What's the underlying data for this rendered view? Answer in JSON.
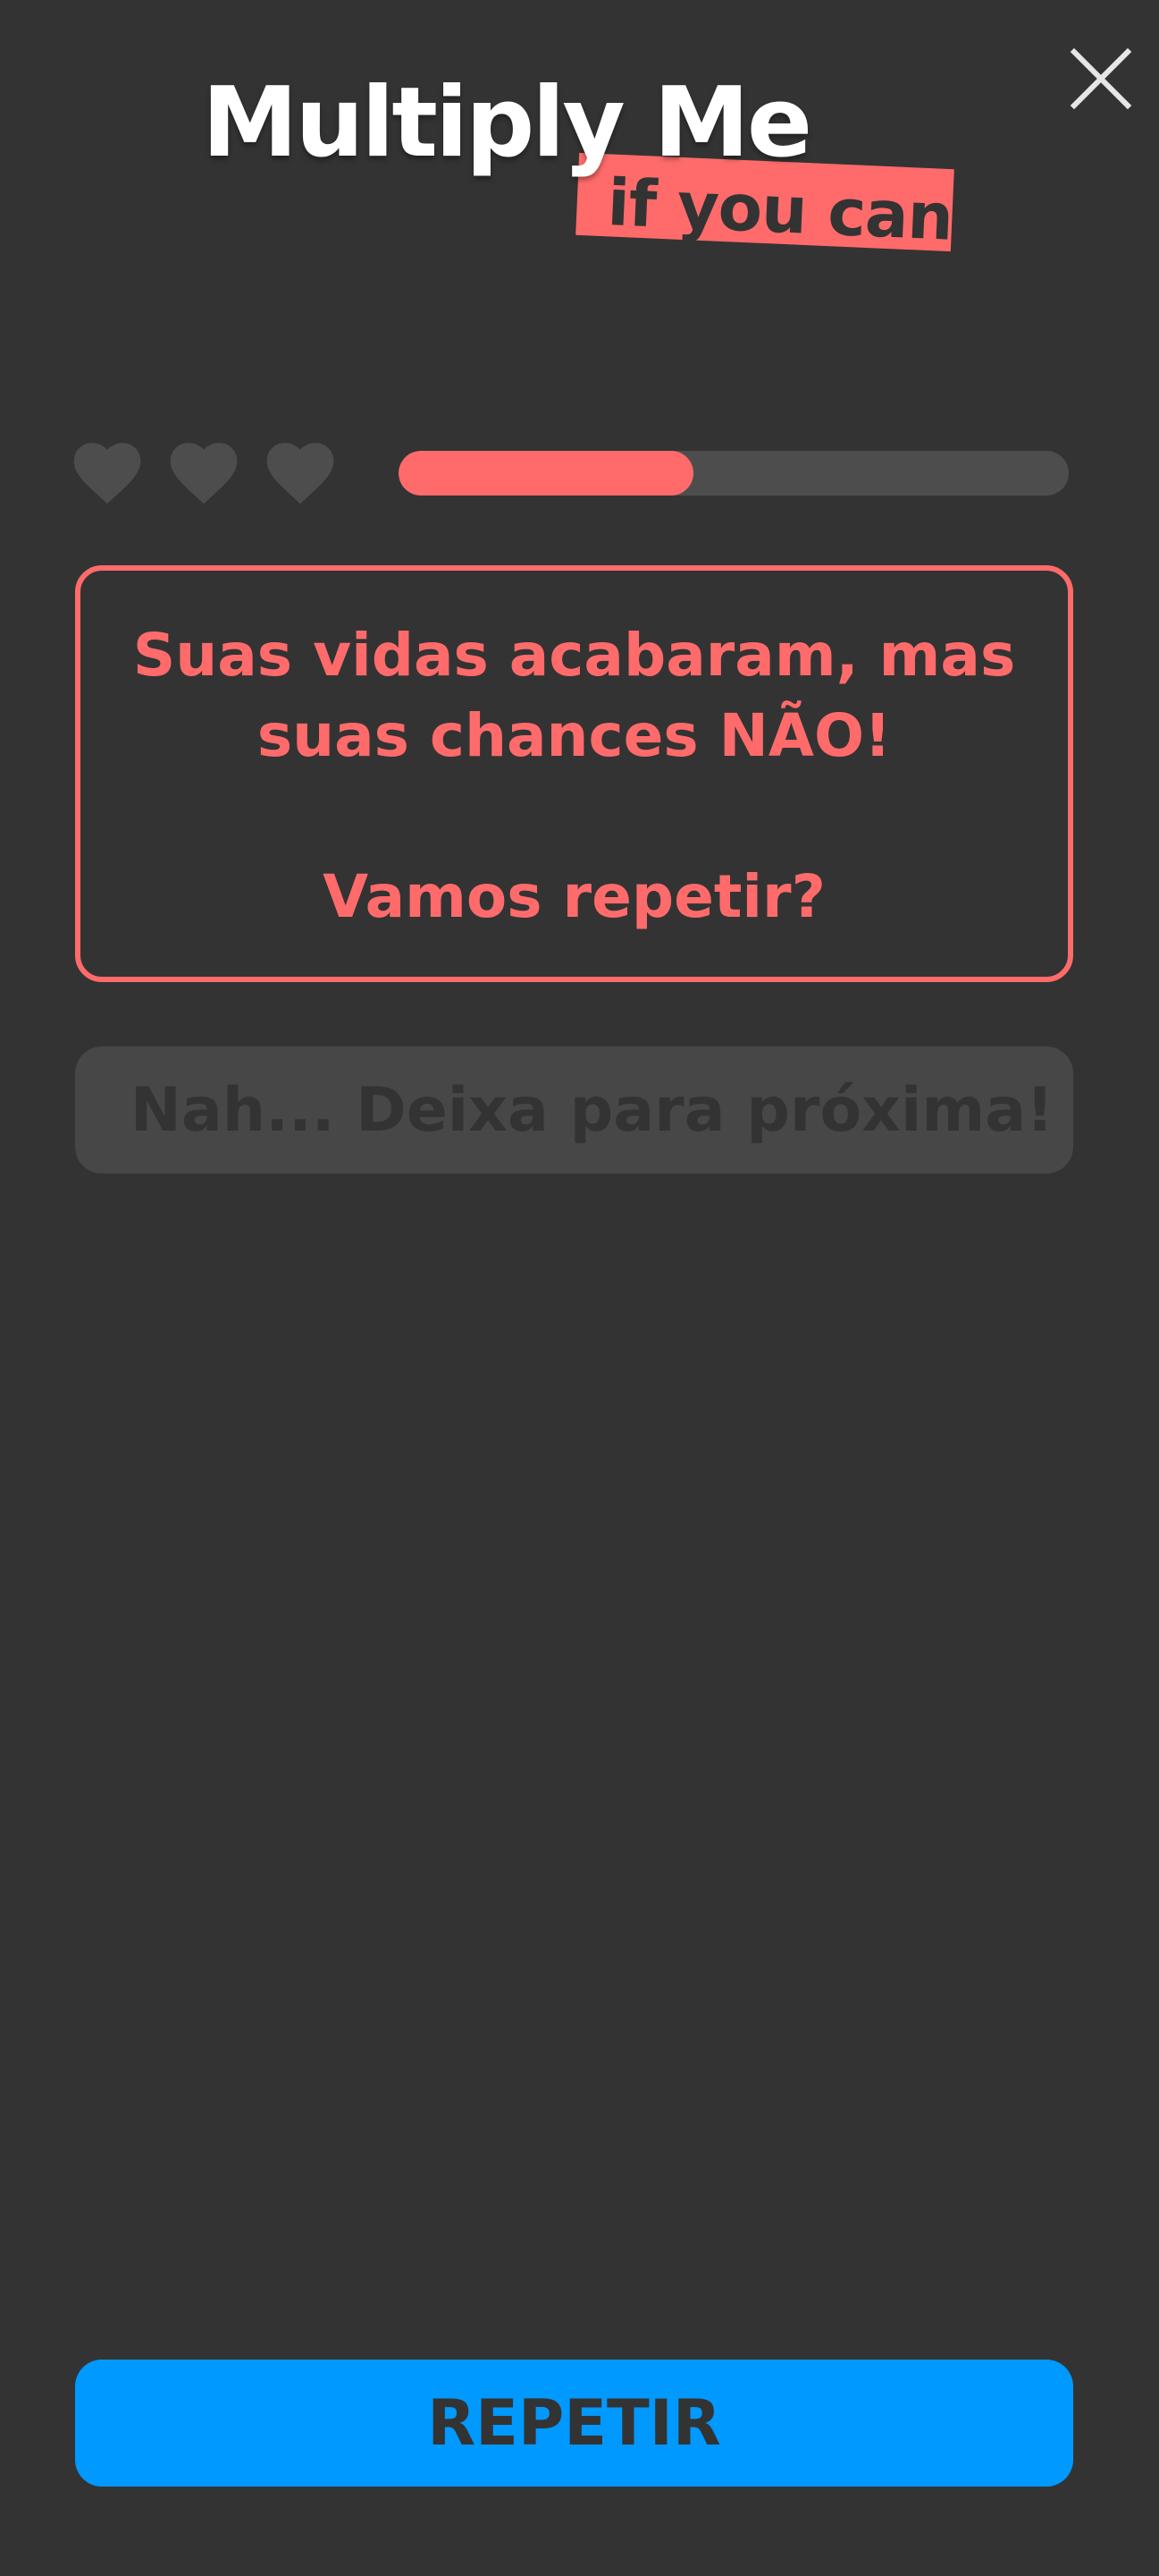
{
  "app": {
    "title": "Multiply Me",
    "tagline": "if you can"
  },
  "header": {
    "close_icon": "close-icon"
  },
  "status": {
    "lives_total": 3,
    "lives_icon": "heart-icon",
    "progress": 0.44
  },
  "message": {
    "line1": "Suas vidas acabaram, mas",
    "line2": "suas chances NÃO!",
    "line3": "Vamos repetir?"
  },
  "actions": {
    "skip_label": "Nah... Deixa para próxima!",
    "repeat_label": "REPETIR"
  },
  "colors": {
    "background": "#333333",
    "accent": "#ff6b6b",
    "primary_button": "#0099ff",
    "muted": "#4d4d4d"
  }
}
